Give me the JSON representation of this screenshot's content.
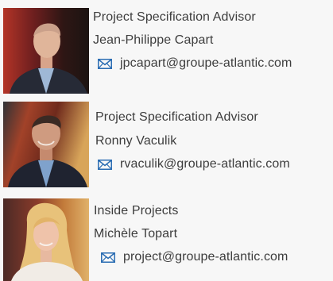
{
  "contacts": [
    {
      "title": "Project Specification Advisor",
      "name": "Jean-Philippe Capart",
      "email": "jpcapart@groupe-atlantic.com"
    },
    {
      "title": "Project Specification Advisor",
      "name": "Ronny Vaculik",
      "email": "rvaculik@groupe-atlantic.com"
    },
    {
      "title": "Inside Projects",
      "name": "Michèle Topart",
      "email": "project@groupe-atlantic.com"
    }
  ],
  "colors": {
    "background": "#f7f7f7",
    "text": "#3d3d3d",
    "mail_icon": "#2b6db3"
  }
}
